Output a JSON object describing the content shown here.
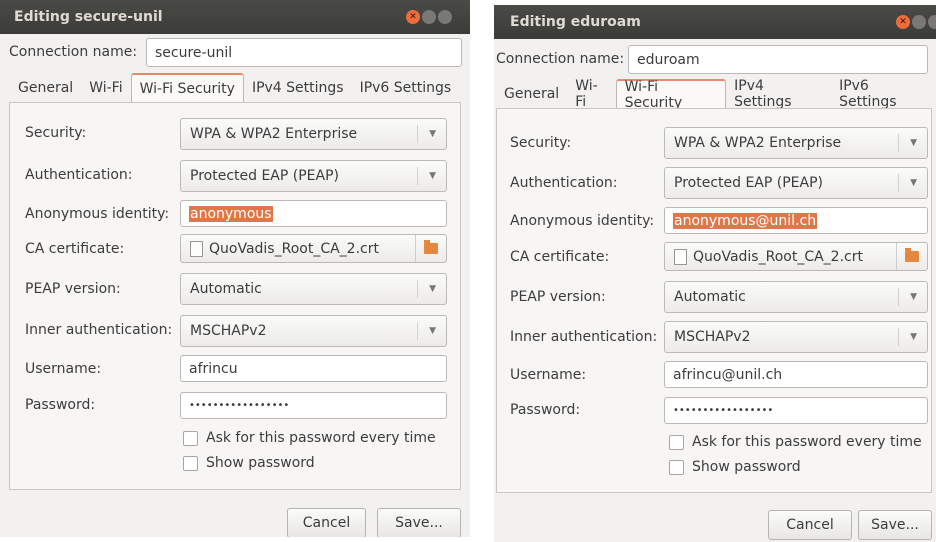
{
  "windows": [
    {
      "title": "Editing secure-unil",
      "connection_name_label": "Connection name:",
      "connection_name_value": "secure-unil",
      "tabs": [
        "General",
        "Wi-Fi",
        "Wi-Fi Security",
        "IPv4 Settings",
        "IPv6 Settings"
      ],
      "active_tab": "Wi-Fi Security",
      "labels": {
        "security": "Security:",
        "authentication": "Authentication:",
        "anonymous_identity": "Anonymous identity:",
        "ca_certificate": "CA certificate:",
        "peap_version": "PEAP version:",
        "inner_authentication": "Inner authentication:",
        "username": "Username:",
        "password": "Password:"
      },
      "values": {
        "security": "WPA & WPA2 Enterprise",
        "authentication": "Protected EAP (PEAP)",
        "anonymous_identity": "anonymous",
        "ca_certificate": "QuoVadis_Root_CA_2.crt",
        "peap_version": "Automatic",
        "inner_authentication": "MSCHAPv2",
        "username": "afrincu",
        "password": "•••••••••••••••••"
      },
      "checkboxes": {
        "ask_password": "Ask for this password every time",
        "show_password": "Show password"
      },
      "buttons": {
        "cancel": "Cancel",
        "save": "Save..."
      }
    },
    {
      "title": "Editing eduroam",
      "connection_name_label": "Connection name:",
      "connection_name_value": "eduroam",
      "tabs": [
        "General",
        "Wi-Fi",
        "Wi-Fi Security",
        "IPv4 Settings",
        "IPv6 Settings"
      ],
      "active_tab": "Wi-Fi Security",
      "labels": {
        "security": "Security:",
        "authentication": "Authentication:",
        "anonymous_identity": "Anonymous identity:",
        "ca_certificate": "CA certificate:",
        "peap_version": "PEAP version:",
        "inner_authentication": "Inner authentication:",
        "username": "Username:",
        "password": "Password:"
      },
      "values": {
        "security": "WPA & WPA2 Enterprise",
        "authentication": "Protected EAP (PEAP)",
        "anonymous_identity": "anonymous@unil.ch",
        "ca_certificate": "QuoVadis_Root_CA_2.crt",
        "peap_version": "Automatic",
        "inner_authentication": "MSCHAPv2",
        "username": "afrincu@unil.ch",
        "password": "•••••••••••••••••"
      },
      "checkboxes": {
        "ask_password": "Ask for this password every time",
        "show_password": "Show password"
      },
      "buttons": {
        "cancel": "Cancel",
        "save": "Save..."
      }
    }
  ],
  "icons": {
    "close": "close-icon",
    "minimize": "minimize-icon",
    "maximize": "maximize-icon",
    "file": "file-icon",
    "folder": "folder-icon",
    "dropdown": "chevron-down-icon"
  },
  "colors": {
    "titlebar": "#3b3b37",
    "close_button": "#ed6c3c",
    "selection": "#e0774a",
    "active_tab_accent": "#e58a6b"
  }
}
